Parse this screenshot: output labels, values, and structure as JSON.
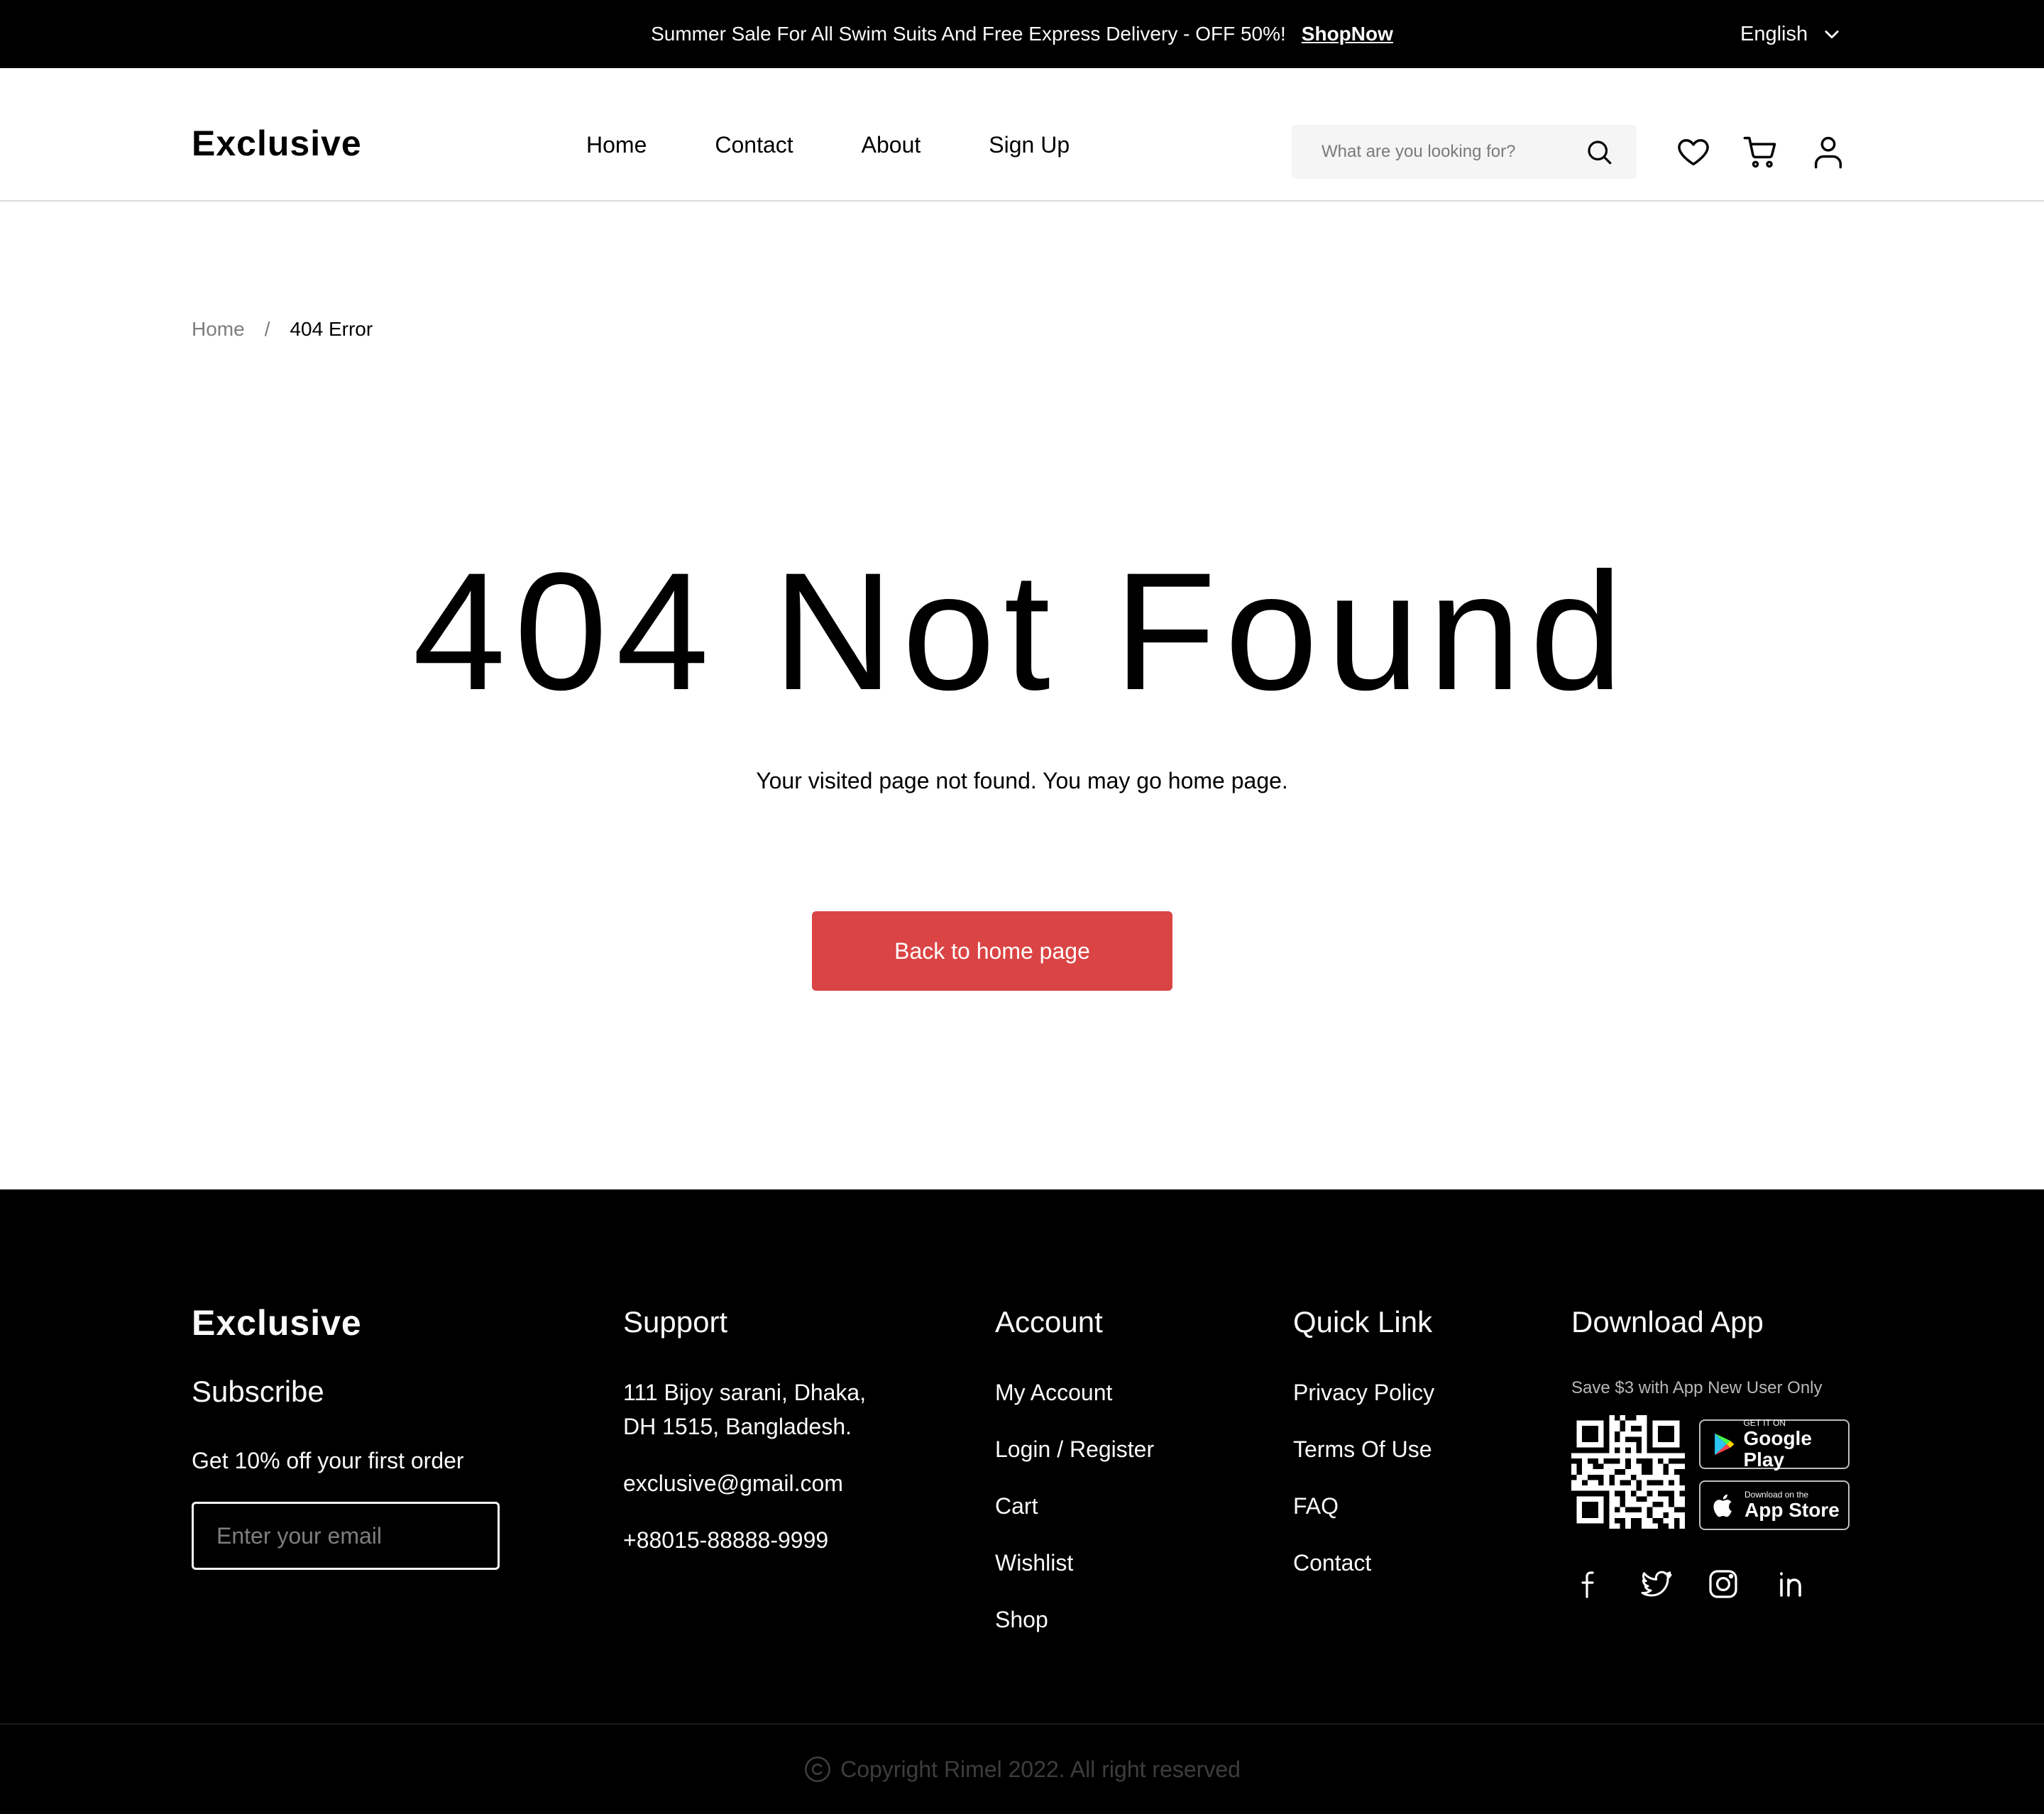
{
  "topbar": {
    "promo_text": "Summer Sale For All Swim Suits And Free Express Delivery - OFF 50%!",
    "shop_link": "ShopNow",
    "language": "English"
  },
  "header": {
    "logo": "Exclusive",
    "nav": [
      "Home",
      "Contact",
      "About",
      "Sign Up"
    ],
    "search_placeholder": "What are you looking for?"
  },
  "breadcrumb": {
    "home": "Home",
    "separator": "/",
    "current": "404 Error"
  },
  "main": {
    "title": "404 Not Found",
    "subtitle": "Your visited page not found. You may go home page.",
    "button_label": "Back to home page"
  },
  "footer": {
    "brand": "Exclusive",
    "subscribe_title": "Subscribe",
    "subscribe_text": "Get 10% off your first order",
    "email_placeholder": "Enter your email",
    "support": {
      "title": "Support",
      "address_line1": "111 Bijoy sarani, Dhaka,",
      "address_line2": "DH 1515, Bangladesh.",
      "email": "exclusive@gmail.com",
      "phone": "+88015-88888-9999"
    },
    "account": {
      "title": "Account",
      "links": [
        "My Account",
        "Login / Register",
        "Cart",
        "Wishlist",
        "Shop"
      ]
    },
    "quick_link": {
      "title": "Quick Link",
      "links": [
        "Privacy Policy",
        "Terms Of Use",
        "FAQ",
        "Contact"
      ]
    },
    "download": {
      "title": "Download App",
      "note": "Save $3 with App New User Only",
      "google_small": "GET IT ON",
      "google_big": "Google Play",
      "apple_small": "Download on the",
      "apple_big": "App Store"
    },
    "social_icons": [
      "facebook-icon",
      "twitter-icon",
      "instagram-icon",
      "linkedin-icon"
    ],
    "copyright": "Copyright Rimel 2022. All right reserved"
  },
  "colors": {
    "accent": "#DB4444",
    "dark": "#000000",
    "light_bg": "#F5F5F5"
  }
}
